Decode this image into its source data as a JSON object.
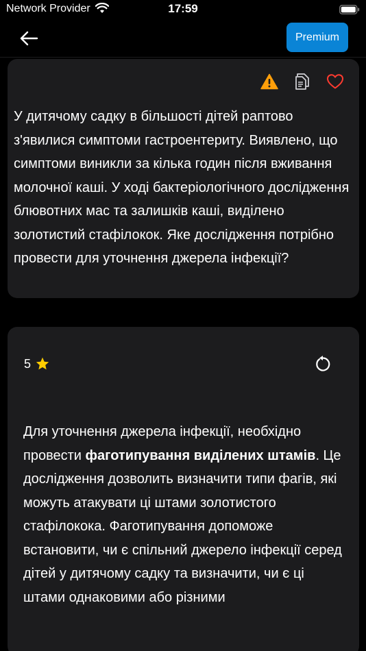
{
  "status_bar": {
    "carrier": "Network Provider",
    "time": "17:59"
  },
  "nav": {
    "premium_label": "Premium"
  },
  "question": {
    "text": "У дитячому садку в більшості дітей раптово з'явилися симптоми гастроентериту. Виявлено, що симптоми виникли за кілька годин після вживання молочної каші. У ході бактеріологічного дослідження блювотних мас та залишків каші, виділено золотистий стафілокок. Яке дослідження потрібно провести для уточнення джерела інфекції?",
    "icons": [
      "warning-icon",
      "copy-icon",
      "heart-icon"
    ]
  },
  "answer": {
    "rating": "5",
    "text_before": "Для уточнення джерела інфекції, необхідно провести ",
    "text_bold": "фаготипування виділених штамів",
    "text_after": ". Це дослідження дозволить визначити типи фагів, які можуть атакувати ці штами золотистого стафілокока. Фаготипування допоможе встановити, чи є спільний джерело інфекції серед дітей у дитячому садку та визначити, чи є ці штами однаковими або різними"
  },
  "colors": {
    "background": "#000000",
    "card": "#1c1c1e",
    "accent": "#0a84d6",
    "warning": "#ff9f0a",
    "heart": "#ff3b30",
    "star": "#ffcc00"
  }
}
